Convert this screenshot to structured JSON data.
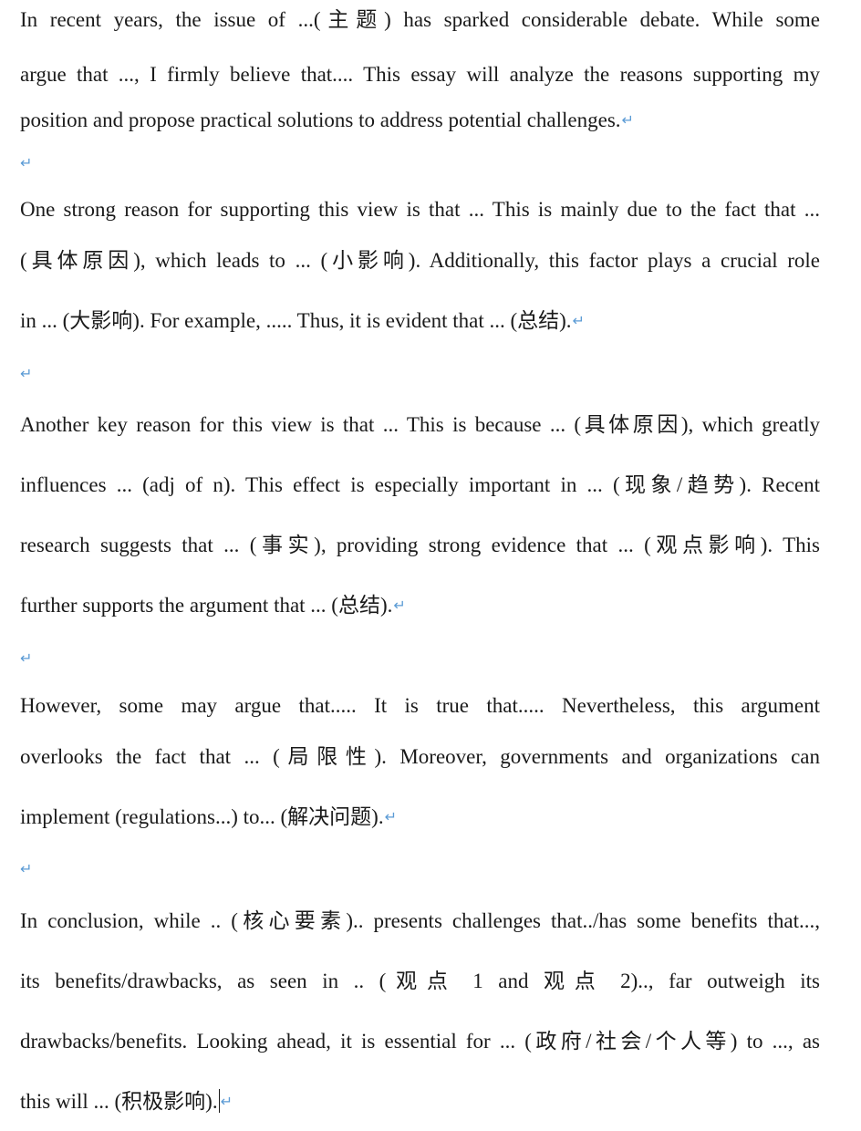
{
  "paragraph_mark": "↵",
  "paragraphs": [
    {
      "lines": [
        "In recent years, the issue of ...(主题) has sparked considerable debate. While some",
        "argue that ..., I firmly believe that.... This essay will analyze the reasons supporting my",
        "position and propose practical solutions to address potential challenges."
      ]
    },
    {
      "lines": [
        "One strong reason for supporting this view is that ... This is mainly due to the fact that ...",
        "(具体原因), which leads to ... (小影响). Additionally, this factor plays a crucial role",
        "in ... (大影响). For example, ..... Thus, it is evident that ... (总结)."
      ]
    },
    {
      "lines": [
        "Another key reason for this view is that ... This is because ... (具体原因), which greatly",
        "influences ... (adj of n). This effect is especially important in ... (现象/趋势). Recent",
        "research suggests that ... (事实), providing strong evidence that ... (观点影响). This",
        "further supports the argument that ... (总结)."
      ]
    },
    {
      "lines": [
        "However, some may argue that..... It is true that..... Nevertheless, this argument",
        "overlooks the fact that ... (局限性). Moreover, governments and organizations can",
        "implement (regulations...) to... (解决问题)."
      ]
    },
    {
      "lines": [
        "In conclusion, while .. (核心要素).. presents challenges that../has some benefits that...,",
        "its benefits/drawbacks, as seen in .. (观点 1 and 观点 2).., far outweigh its",
        "drawbacks/benefits. Looking ahead, it is essential for ... (政府/社会/个人等) to ..., as",
        "this will ... (积极影响)."
      ]
    }
  ]
}
